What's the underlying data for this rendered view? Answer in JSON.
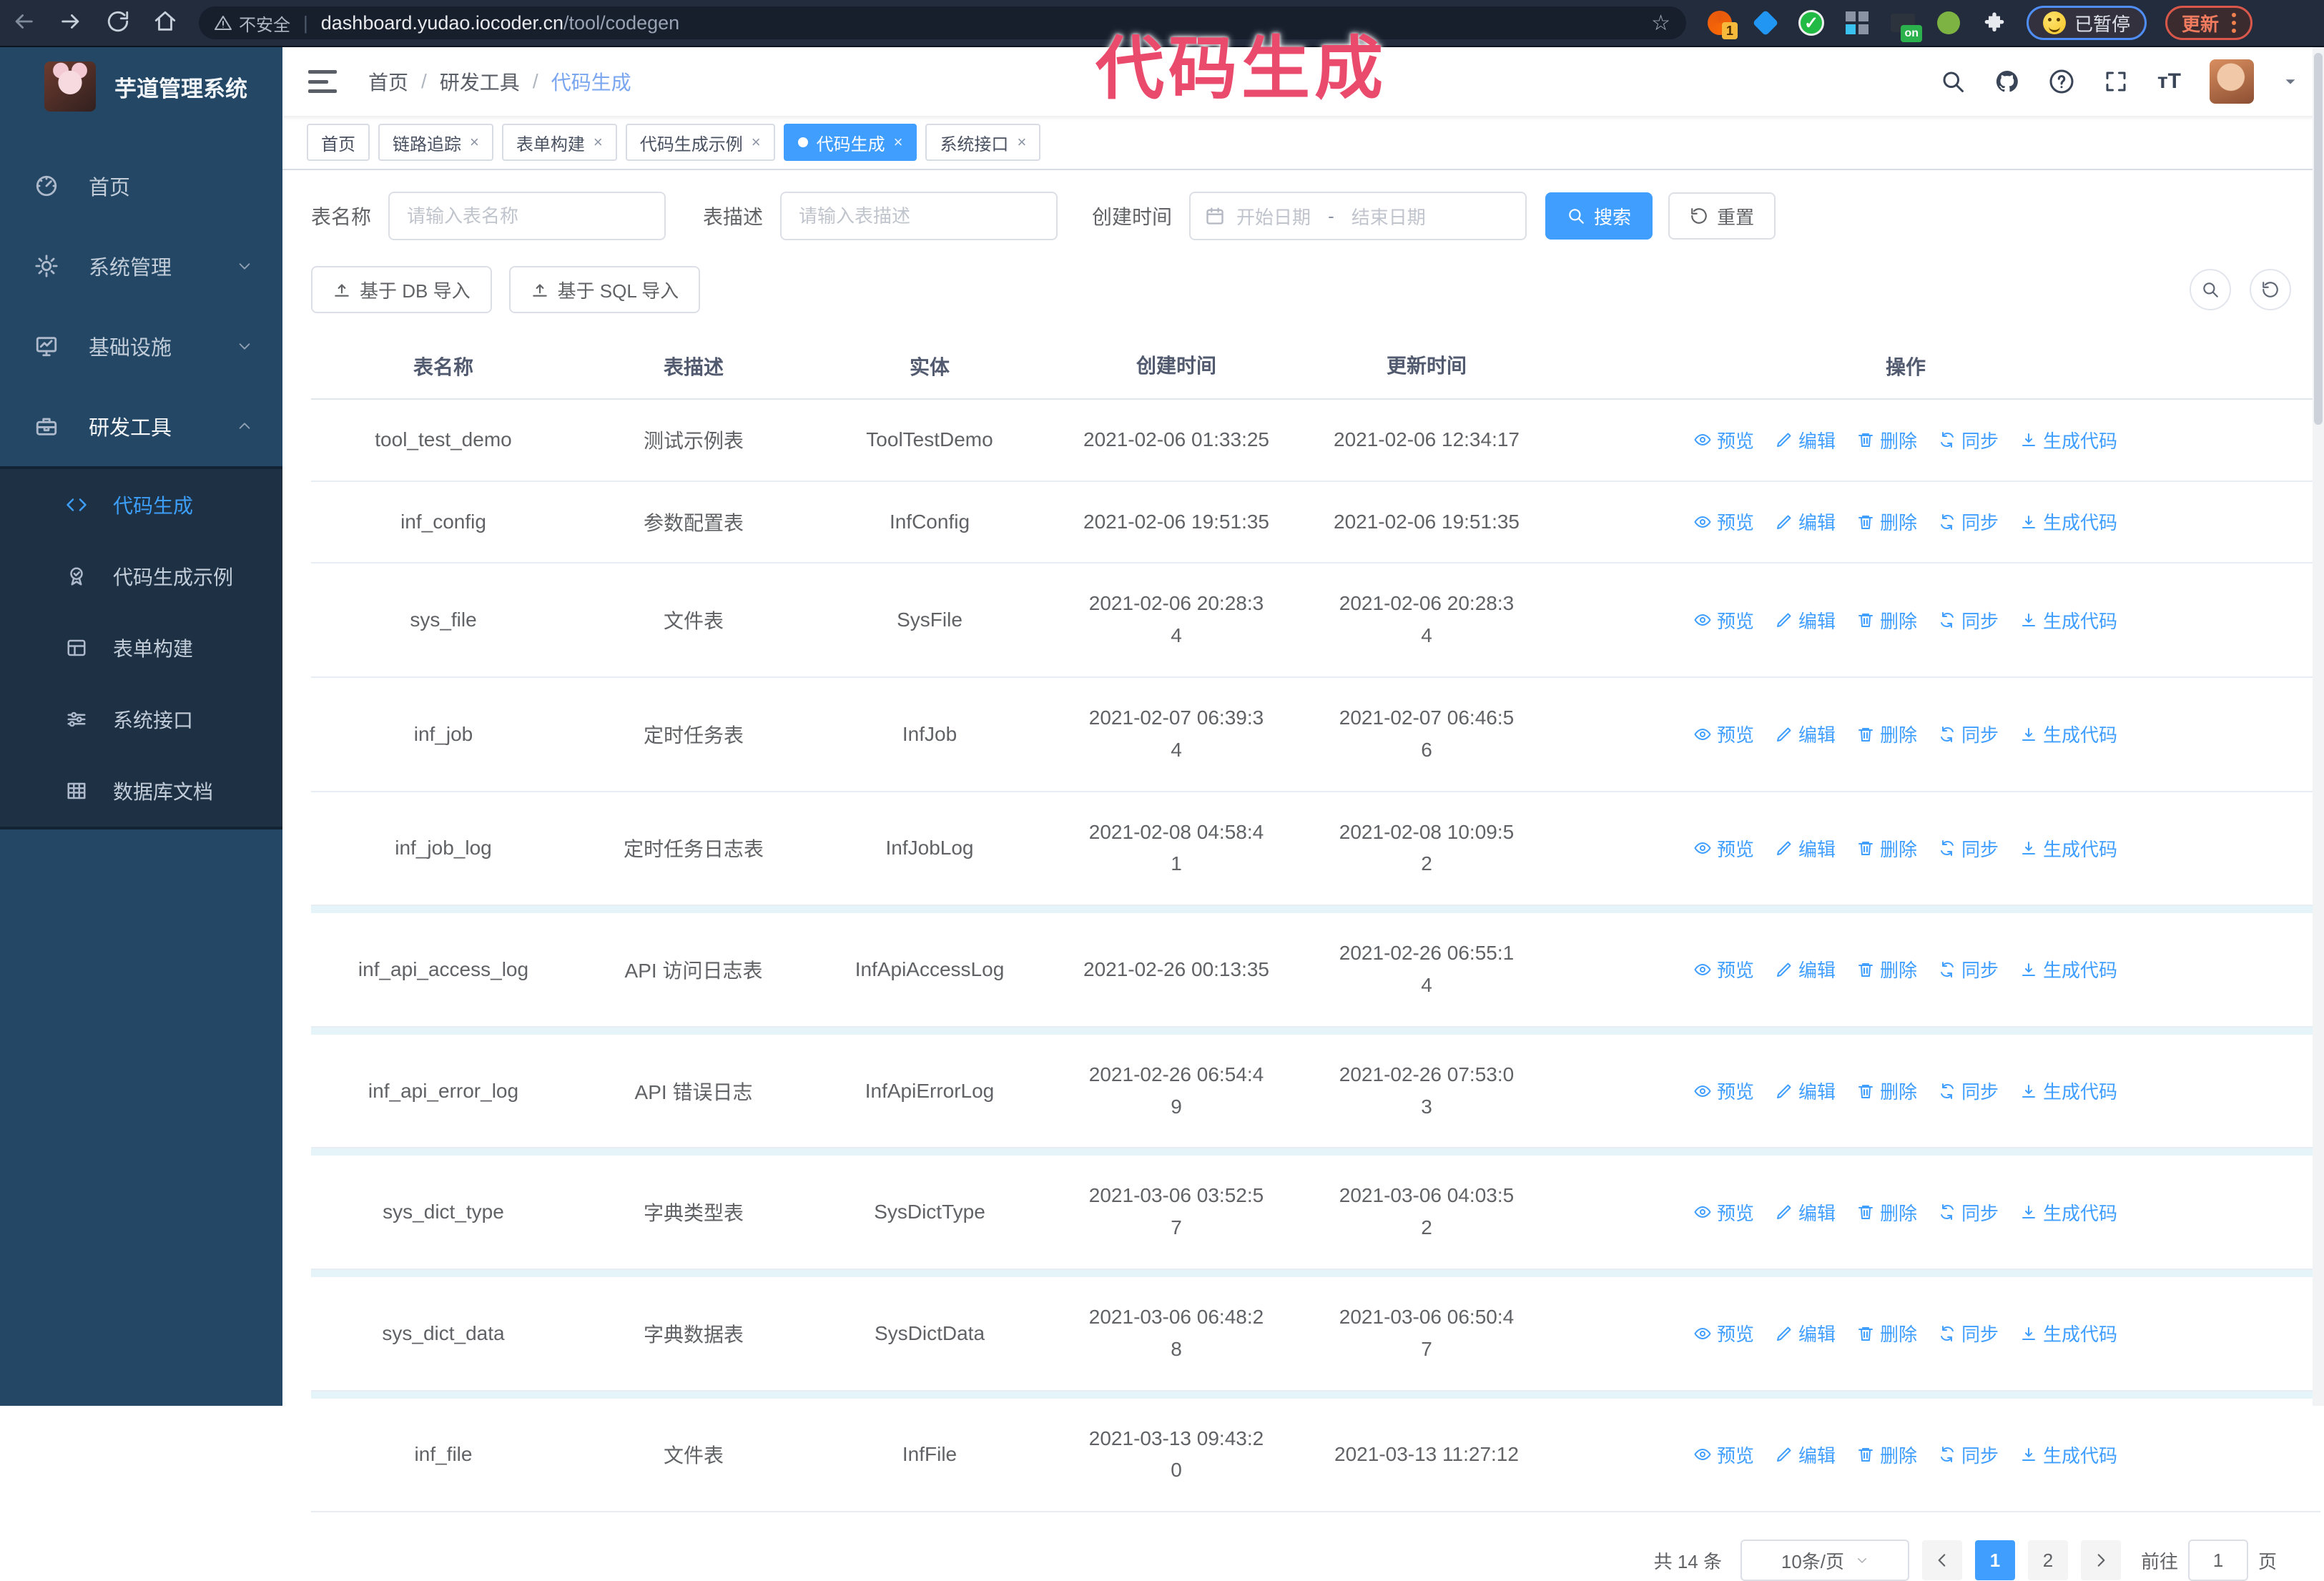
{
  "ui": {
    "slash": "/",
    "dash": "-",
    "pipe": "|",
    "close": "×",
    "back": "←",
    "forward": "→",
    "home": "⌂",
    "star": "☆"
  },
  "browser": {
    "security_label": "不安全",
    "url_host": "dashboard.yudao.iocoder.cn",
    "url_path": "/tool/codegen",
    "extension_badge_count": "1",
    "extension_badge_on": "on",
    "check_glyph": "✓",
    "puzzle_glyph": "⚑",
    "paused_badge_label": "已暂停",
    "update_badge_label": "更新"
  },
  "annotation": {
    "text": "代码生成",
    "color": "#ea4b6d"
  },
  "sidebar": {
    "app_title": "芋道管理系统",
    "menu": [
      {
        "label": "首页"
      },
      {
        "label": "系统管理"
      },
      {
        "label": "基础设施"
      },
      {
        "label": "研发工具"
      }
    ],
    "submenu": [
      {
        "label": "代码生成"
      },
      {
        "label": "代码生成示例"
      },
      {
        "label": "表单构建"
      },
      {
        "label": "系统接口"
      },
      {
        "label": "数据库文档"
      }
    ]
  },
  "breadcrumb": {
    "items": [
      "首页",
      "研发工具",
      "代码生成"
    ]
  },
  "tabs": [
    {
      "label": "首页"
    },
    {
      "label": "链路追踪"
    },
    {
      "label": "表单构建"
    },
    {
      "label": "代码生成示例"
    },
    {
      "label": "代码生成"
    },
    {
      "label": "系统接口"
    }
  ],
  "filters": {
    "table_name_label": "表名称",
    "table_name_placeholder": "请输入表名称",
    "table_desc_label": "表描述",
    "table_desc_placeholder": "请输入表描述",
    "create_time_label": "创建时间",
    "date_start_placeholder": "开始日期",
    "date_end_placeholder": "结束日期",
    "search_label": "搜索",
    "reset_label": "重置"
  },
  "toolbar": {
    "import_db_label": "基于 DB 导入",
    "import_sql_label": "基于 SQL 导入"
  },
  "table": {
    "columns": [
      "表名称",
      "表描述",
      "实体",
      "创建时间",
      "更新时间",
      "操作"
    ],
    "actions": {
      "preview": "预览",
      "edit": "编辑",
      "delete": "删除",
      "sync": "同步",
      "generate": "生成代码"
    },
    "rows": [
      {
        "name": "tool_test_demo",
        "desc": "测试示例表",
        "entity": "ToolTestDemo",
        "created": "2021-02-06 01:33:25",
        "updated": "2021-02-06 12:34:17"
      },
      {
        "name": "inf_config",
        "desc": "参数配置表",
        "entity": "InfConfig",
        "created": "2021-02-06 19:51:35",
        "updated": "2021-02-06 19:51:35"
      },
      {
        "name": "sys_file",
        "desc": "文件表",
        "entity": "SysFile",
        "created": "2021-02-06 20:28:3\n4",
        "updated": "2021-02-06 20:28:3\n4"
      },
      {
        "name": "inf_job",
        "desc": "定时任务表",
        "entity": "InfJob",
        "created": "2021-02-07 06:39:3\n4",
        "updated": "2021-02-07 06:46:5\n6"
      },
      {
        "name": "inf_job_log",
        "desc": "定时任务日志表",
        "entity": "InfJobLog",
        "created": "2021-02-08 04:58:4\n1",
        "updated": "2021-02-08 10:09:5\n2"
      },
      {
        "name": "inf_api_access_log",
        "desc": "API 访问日志表",
        "entity": "InfApiAccessLog",
        "created": "2021-02-26 00:13:35",
        "updated": "2021-02-26 06:55:1\n4"
      },
      {
        "name": "inf_api_error_log",
        "desc": "API 错误日志",
        "entity": "InfApiErrorLog",
        "created": "2021-02-26 06:54:4\n9",
        "updated": "2021-02-26 07:53:0\n3"
      },
      {
        "name": "sys_dict_type",
        "desc": "字典类型表",
        "entity": "SysDictType",
        "created": "2021-03-06 03:52:5\n7",
        "updated": "2021-03-06 04:03:5\n2"
      },
      {
        "name": "sys_dict_data",
        "desc": "字典数据表",
        "entity": "SysDictData",
        "created": "2021-03-06 06:48:2\n8",
        "updated": "2021-03-06 06:50:4\n7"
      },
      {
        "name": "inf_file",
        "desc": "文件表",
        "entity": "InfFile",
        "created": "2021-03-13 09:43:2\n0",
        "updated": "2021-03-13 11:27:12"
      }
    ]
  },
  "pagination": {
    "total_label": "共 14 条",
    "page_size_label": "10条/页",
    "page_1": "1",
    "page_2": "2",
    "goto_label": "前往",
    "goto_value": "1",
    "page_unit_label": "页"
  }
}
